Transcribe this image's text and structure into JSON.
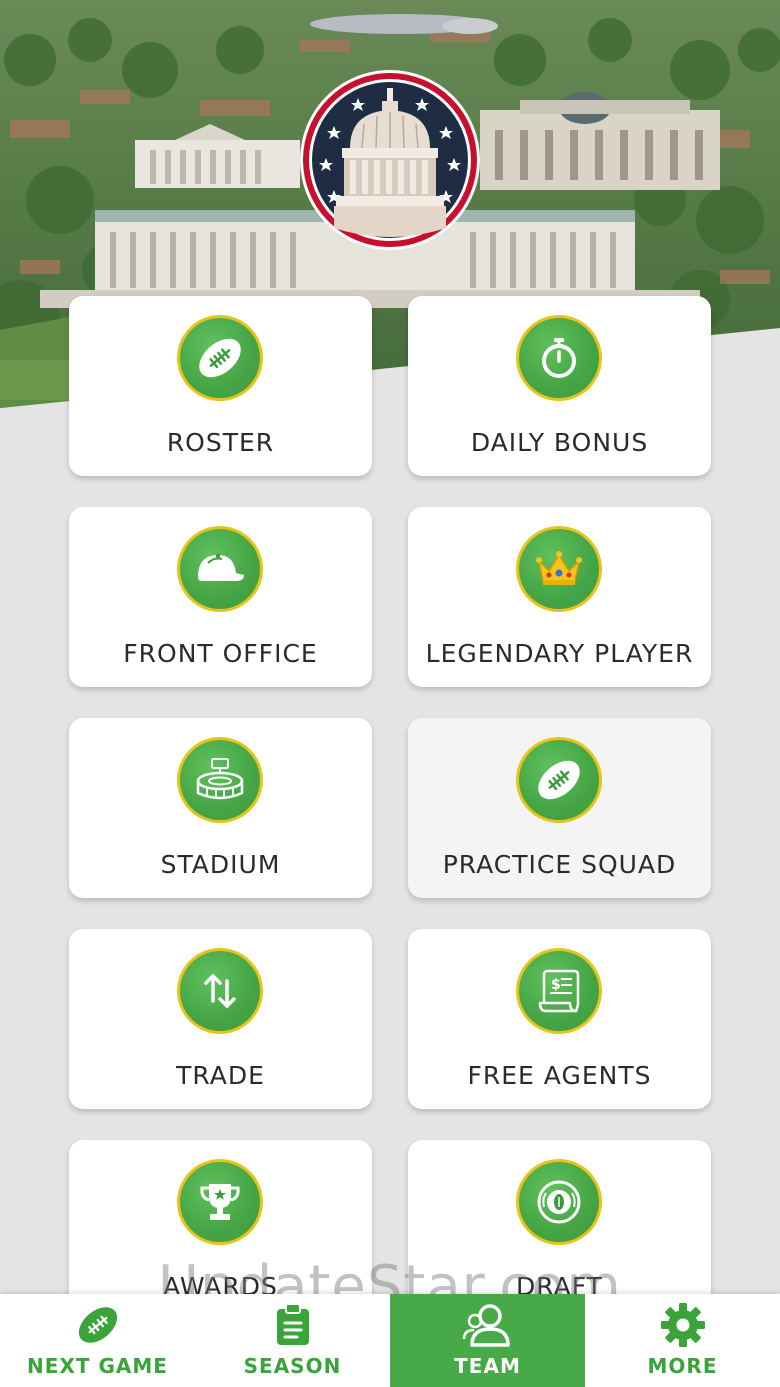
{
  "colors": {
    "brand_green": "#47a947",
    "icon_ring": "#e8c31a",
    "badge_navy": "#1f2d44",
    "badge_red": "#c8102e",
    "tile_bg": "#ffffff",
    "page_bg": "#e4e4e4"
  },
  "header": {
    "team_badge_icon": "capitol-dome-badge-icon"
  },
  "tiles": [
    {
      "label": "ROSTER",
      "icon": "football-icon"
    },
    {
      "label": "DAILY BONUS",
      "icon": "stopwatch-icon"
    },
    {
      "label": "FRONT OFFICE",
      "icon": "cap-icon"
    },
    {
      "label": "LEGENDARY PLAYER",
      "icon": "crown-icon"
    },
    {
      "label": "STADIUM",
      "icon": "stadium-icon"
    },
    {
      "label": "PRACTICE SQUAD",
      "icon": "football-icon"
    },
    {
      "label": "TRADE",
      "icon": "swap-arrows-icon"
    },
    {
      "label": "FREE AGENTS",
      "icon": "contract-scroll-icon"
    },
    {
      "label": "AWARDS",
      "icon": "trophy-icon"
    },
    {
      "label": "DRAFT",
      "icon": "draft-emblem-icon"
    }
  ],
  "watermark": "UpdateStar.com",
  "nav": {
    "items": [
      {
        "label": "NEXT GAME",
        "icon": "football-icon",
        "active": false
      },
      {
        "label": "SEASON",
        "icon": "clipboard-icon",
        "active": false
      },
      {
        "label": "TEAM",
        "icon": "team-icon",
        "active": true
      },
      {
        "label": "MORE",
        "icon": "gear-icon",
        "active": false
      }
    ]
  }
}
